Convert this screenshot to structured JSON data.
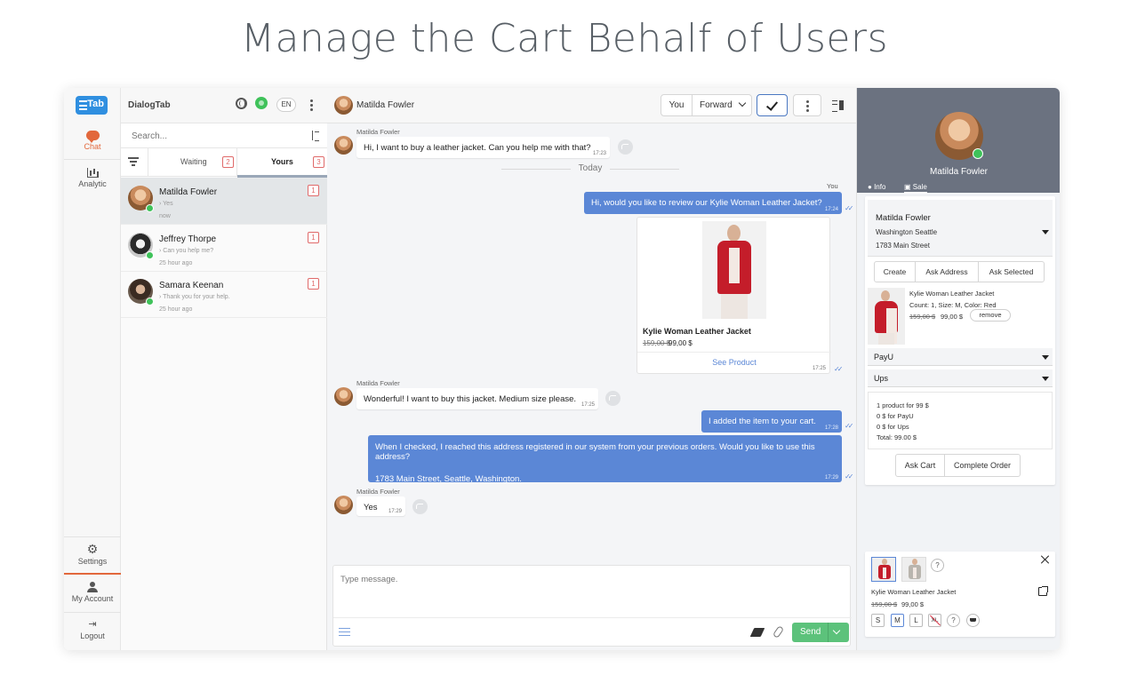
{
  "headline": "Manage the Cart Behalf of Users",
  "nav": {
    "logo_text": "Tab",
    "items": [
      {
        "label": "Chat",
        "icon": "chat-bubble-icon"
      },
      {
        "label": "Analytic",
        "icon": "bar-chart-icon"
      },
      {
        "label": "Settings",
        "icon": "gears-icon"
      },
      {
        "label": "My Account",
        "icon": "user-icon"
      },
      {
        "label": "Logout",
        "icon": "logout-icon"
      }
    ]
  },
  "list": {
    "brand": "DialogTab",
    "lang": "EN",
    "search_placeholder": "Search...",
    "tabs": [
      {
        "label": "Waiting",
        "count": "2"
      },
      {
        "label": "Yours",
        "count": "3"
      }
    ],
    "conversations": [
      {
        "name": "Matilda Fowler",
        "preview": "› Yes",
        "time": "now",
        "count": "1"
      },
      {
        "name": "Jeffrey Thorpe",
        "preview": "› Can you help me?",
        "time": "25 hour ago",
        "count": "1"
      },
      {
        "name": "Samara Keenan",
        "preview": "› Thank you for your help.",
        "time": "25 hour ago",
        "count": "1"
      }
    ]
  },
  "chat": {
    "contact": "Matilda Fowler",
    "you_btn": "You",
    "forward_btn": "Forward",
    "today": "Today",
    "you_label": "You",
    "messages": {
      "m1_sender": "Matilda Fowler",
      "m1_text": "Hi, I want to buy a leather jacket. Can you help me with that?",
      "m1_time": "17:23",
      "m2_text": "Hi, would you like to review our Kylie Woman Leather Jacket?",
      "m2_time": "17:24",
      "product_title": "Kylie Woman Leather Jacket",
      "product_old_price": "159,00 $",
      "product_new_price": "99,00 $",
      "product_link": "See Product",
      "product_time": "17:25",
      "m3_sender": "Matilda Fowler",
      "m3_text": "Wonderful! I want to buy this jacket. Medium size please.",
      "m3_time": "17:25",
      "m4_text": "I added the item to your cart.",
      "m4_time": "17:28",
      "m5_text_1": "When I checked, I reached this address registered in our system from your previous orders. Would you like to use this address?",
      "m5_text_2": "1783 Main Street, Seattle, Washington.",
      "m5_time": "17:29",
      "m6_sender": "Matilda Fowler",
      "m6_text": "Yes",
      "m6_time": "17:29"
    },
    "composer_placeholder": "Type message.",
    "send_label": "Send"
  },
  "side": {
    "name": "Matilda Fowler",
    "tab_info": "Info",
    "tab_sale": "Sale",
    "address": {
      "name": "Matilda Fowler",
      "line1": "Washington Seattle",
      "line2": "1783 Main Street"
    },
    "buttons": {
      "create": "Create",
      "ask_address": "Ask Address",
      "ask_selected": "Ask Selected"
    },
    "cart_item": {
      "title": "Kylie Woman Leather Jacket",
      "meta": "Count: 1, Size: M, Color: Red",
      "old_price": "159,00 $",
      "new_price": "99,00 $",
      "remove": "remove"
    },
    "payment": "PayU",
    "shipping": "Ups",
    "summary": [
      "1 product for 99 $",
      "0 $ for PayU",
      "0 $ for Ups",
      "Total: 99.00 $"
    ],
    "ask_cart": "Ask Cart",
    "complete_order": "Complete Order",
    "mini": {
      "title": "Kylie Woman Leather Jacket",
      "old_price": "159,00 $",
      "new_price": "99,00 $",
      "help": "?",
      "sizes": [
        "S",
        "M",
        "L",
        "XL"
      ],
      "selected_size": "M"
    }
  }
}
